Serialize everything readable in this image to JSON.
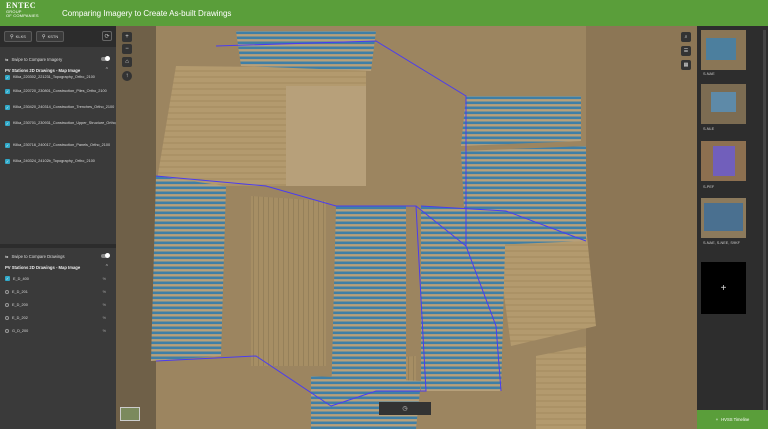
{
  "header": {
    "logo_line1": "ENTEC",
    "logo_line2": "GROUP",
    "logo_line3": "OF COMPANIES",
    "title": "Comparing Imagery to Create As-built Drawings",
    "background": "#5a9e3a"
  },
  "left_panel": {
    "chips": [
      {
        "icon": "pin-icon",
        "label": "KLKS"
      },
      {
        "icon": "pin-icon",
        "label": "KSTN"
      }
    ],
    "imagery": {
      "swipe_label": "Swipe to Compare Imagery",
      "group_title": "PV Stations 2D Drawings - Map Image",
      "layers": [
        "Kilka_220302_221231_Topography_Ortho_2100",
        "Kilka_220720_230801_Construction_Piles_Ortho_2100",
        "Kilka_230420_240314_Construction_Trenches_Ortho_2100",
        "Kilka_230701_230931_Construction_Upper_Structure_Ortho_2100",
        "Kilka_230716_240017_Construction_Panels_Ortho_2100",
        "Kilka_240324_24102b_Topography_Ortho_2100"
      ]
    },
    "drawings": {
      "swipe_label": "Swipe to Compare Drawings",
      "group_title": "PV Stations 2D Drawings - Map Image",
      "layers": [
        {
          "label": "E_D_400",
          "pct": "%"
        },
        {
          "label": "E_D_201",
          "pct": "%"
        },
        {
          "label": "E_D_200",
          "pct": "%"
        },
        {
          "label": "E_D_202",
          "pct": "%"
        },
        {
          "label": "G_D_200",
          "pct": "%"
        }
      ]
    }
  },
  "map": {
    "zoom_in": "+",
    "zoom_out": "−",
    "home_icon": "home-icon",
    "compass_icon": "compass-icon",
    "bottom_icon": "clock-icon",
    "right_controls": [
      "search-icon",
      "layers-icon",
      "grid-icon"
    ]
  },
  "right_panel": {
    "thumbnails": [
      {
        "label": "S-NAE"
      },
      {
        "label": "S-NLE"
      },
      {
        "label": "S-PEF"
      },
      {
        "label": "S-NAE, S-NEE, S9KF"
      }
    ],
    "add_label": "+",
    "timeline_label": "HVSS Timeline"
  }
}
